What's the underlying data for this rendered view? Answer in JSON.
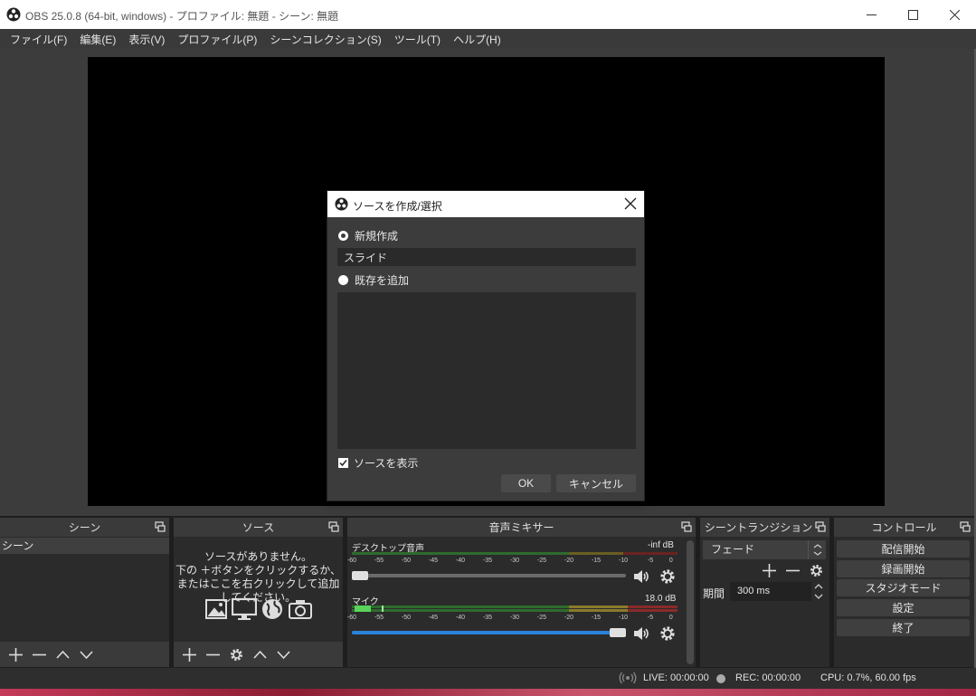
{
  "window": {
    "title": "OBS 25.0.8 (64-bit, windows) - プロファイル: 無題 - シーン: 無題",
    "app_icon": "obs-logo-icon",
    "controls": [
      "minimize-icon",
      "maximize-icon",
      "close-icon"
    ]
  },
  "menu": [
    "ファイル(F)",
    "編集(E)",
    "表示(V)",
    "プロファイル(P)",
    "シーンコレクション(S)",
    "ツール(T)",
    "ヘルプ(H)"
  ],
  "dialog": {
    "title": "ソースを作成/選択",
    "create_new_label": "新規作成",
    "name_value": "スライド",
    "add_existing_label": "既存を追加",
    "show_source_label": "ソースを表示",
    "ok_label": "OK",
    "cancel_label": "キャンセル"
  },
  "scenes": {
    "title": "シーン",
    "items": [
      "シーン"
    ]
  },
  "sources": {
    "title": "ソース",
    "empty_line1": "ソースがありません。",
    "empty_line2": "下の ＋ボタンをクリックするか、",
    "empty_line3": "またはここを右クリックして追加してください。",
    "icons": [
      "image-icon",
      "monitor-icon",
      "globe-icon",
      "camera-icon"
    ]
  },
  "mixer": {
    "title": "音声ミキサー",
    "channels": [
      {
        "name": "デスクトップ音声",
        "level": "-inf dB",
        "volume": 0.0
      },
      {
        "name": "マイク",
        "level": "18.0 dB",
        "volume": 1.0
      }
    ],
    "ticks": [
      "-60",
      "-55",
      "-50",
      "-45",
      "-40",
      "-35",
      "-30",
      "-25",
      "-20",
      "-15",
      "-10",
      "-5",
      "0"
    ]
  },
  "transitions": {
    "title": "シーントランジション",
    "selected": "フェード",
    "duration_label": "期間",
    "duration_value": "300 ms"
  },
  "controls": {
    "title": "コントロール",
    "start_streaming": "配信開始",
    "start_recording": "録画開始",
    "studio_mode": "スタジオモード",
    "settings": "設定",
    "exit": "終了"
  },
  "status": {
    "live": "LIVE: 00:00:00",
    "rec": "REC: 00:00:00",
    "cpu": "CPU: 0.7%, 60.00 fps"
  },
  "colors": {
    "accent": "#2a82da",
    "meter_green": "#4caf50",
    "meter_yellow": "#c8b23a",
    "meter_red": "#d04040"
  }
}
